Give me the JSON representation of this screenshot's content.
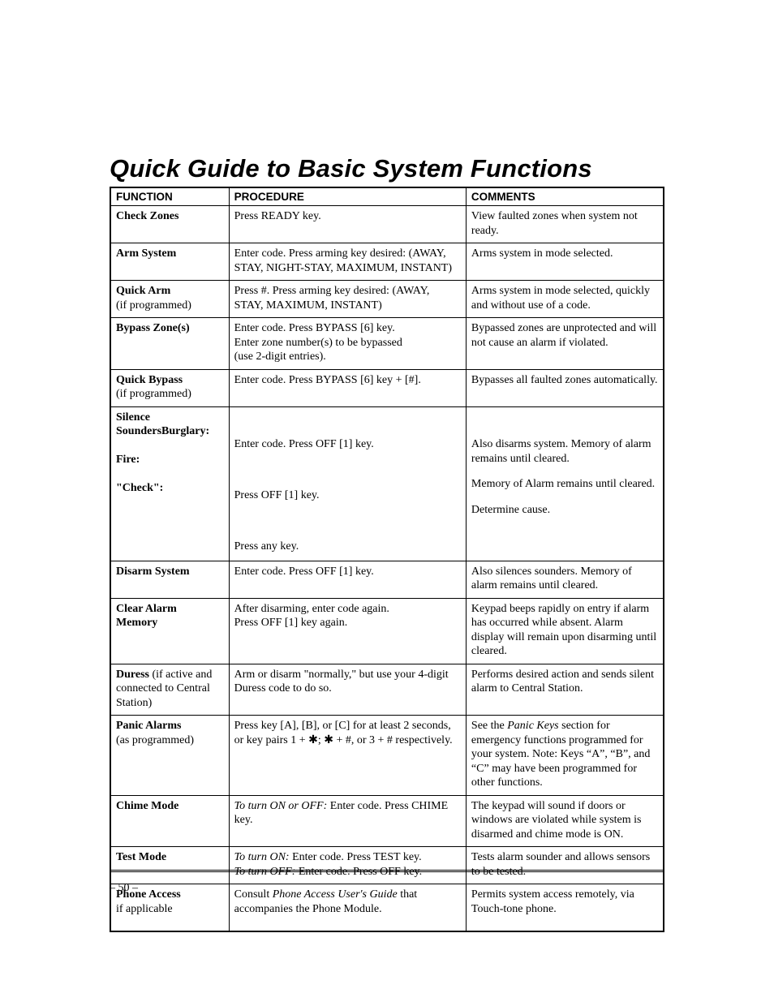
{
  "title": "Quick Guide to Basic System Functions",
  "headers": {
    "function": "FUNCTION",
    "procedure": "PROCEDURE",
    "comments": "COMMENTS"
  },
  "rows": [
    {
      "function_html": "<span class='fn-name'>Check Zones</span>",
      "procedure_html": "Press READY key.",
      "comments_html": "View faulted zones when system not ready."
    },
    {
      "function_html": "<span class='fn-name'>Arm System</span>",
      "procedure_html": "Enter code. Press arming key desired: (AWAY, STAY, NIGHT-STAY, MAXIMUM, INSTANT)",
      "comments_html": "Arms system in mode selected."
    },
    {
      "function_html": "<span class='fn-name'>Quick Arm</span><br><span class='fn-sub'>(if programmed)</span>",
      "procedure_html": "Press #. Press arming key desired: (AWAY, STAY, MAXIMUM, INSTANT)",
      "comments_html": "Arms system in mode selected, quickly and without use of a code."
    },
    {
      "function_html": "<span class='fn-name'>Bypass Zone(s)</span>",
      "procedure_html": "Enter code. Press BYPASS [6] key.<br>Enter zone number(s) to be bypassed<br>(use 2-digit entries).",
      "comments_html": "Bypassed zones are unprotected and will not cause an alarm if violated."
    },
    {
      "function_html": "<span class='fn-name'>Quick Bypass</span><br><span class='fn-sub'>(if programmed)</span>",
      "procedure_html": "Enter code. Press BYPASS [6] key + [#].",
      "comments_html": "Bypasses all faulted zones automatically."
    },
    {
      "function_html": "<span class='fn-name'>Silence Sounders</span><span class='fn-name right'>Burglary:</span><br><br><span class='fn-name right'>Fire:</span><br><br><span class='fn-name right'>\"Check\":</span>",
      "procedure_html": "<div class='blk'>&nbsp;</div><div class='blk'>Enter code. Press OFF [1] key.</div><div class='blk'>&nbsp;</div><div class='blk'>Press OFF [1] key.</div><div class='blk'>&nbsp;</div><div class='blk'>Press any key.</div>",
      "comments_html": "<div class='blk'>&nbsp;</div><div class='blk'>Also disarms system. Memory of alarm remains until cleared.</div><div class='blk'>Memory of Alarm remains until cleared.</div><div class='blk'>Determine cause.</div>",
      "multi": true
    },
    {
      "function_html": "<span class='fn-name'>Disarm System</span>",
      "procedure_html": "Enter code. Press OFF [1] key.",
      "comments_html": "Also silences sounders. Memory of alarm remains until cleared."
    },
    {
      "function_html": "<span class='fn-name'>Clear Alarm<br>Memory</span>",
      "procedure_html": "After disarming, enter code again.<br>Press OFF [1] key again.",
      "comments_html": "Keypad beeps rapidly on entry if alarm has occurred while absent. Alarm display will remain upon disarming until cleared."
    },
    {
      "function_html": "<span class='fn-name'>Duress</span> <span class='fn-sub'>(if active and connected to Central Station)</span>",
      "procedure_html": "Arm or disarm \"normally,\" but use your 4-digit Duress code to do so.",
      "comments_html": "Performs desired action and sends silent alarm to Central Station."
    },
    {
      "function_html": "<span class='fn-name'>Panic Alarms</span><br><span class='fn-sub'>(as programmed)</span>",
      "procedure_html": "Press key [A], [B], or [C] for at least 2 seconds, or key pairs 1 + ✱; ✱ + #, or 3 + # respectively.",
      "comments_html": "See the <span class='ital'>Panic Keys</span> section for emergency functions programmed for your system. Note: Keys “A”, “B”, and “C” may have been programmed for other functions."
    },
    {
      "function_html": "<span class='fn-name'>Chime Mode</span>",
      "procedure_html": "<span class='ital'>To turn ON or OFF:</span> Enter code. Press CHIME key.",
      "comments_html": "The keypad will sound if doors or windows are violated while system is disarmed and chime mode is ON."
    },
    {
      "function_html": "<span class='fn-name'>Test Mode</span>",
      "procedure_html": "<span class='ital'>To turn ON:</span> Enter code. Press TEST key.<br><span class='ital'>To turn OFF:</span> Enter code. Press OFF key.",
      "comments_html": "Tests alarm sounder and allows sensors to be tested."
    },
    {
      "function_html": "<span class='fn-name'>Phone Access</span><br><span class='fn-sub'>if applicable</span>",
      "procedure_html": "Consult <span class='ital'>Phone Access User's Guide</span> that accompanies the Phone Module.",
      "comments_html": "Permits system access remotely, via Touch-tone phone.",
      "extra_pad": true
    }
  ],
  "page_number": "– 50 –"
}
